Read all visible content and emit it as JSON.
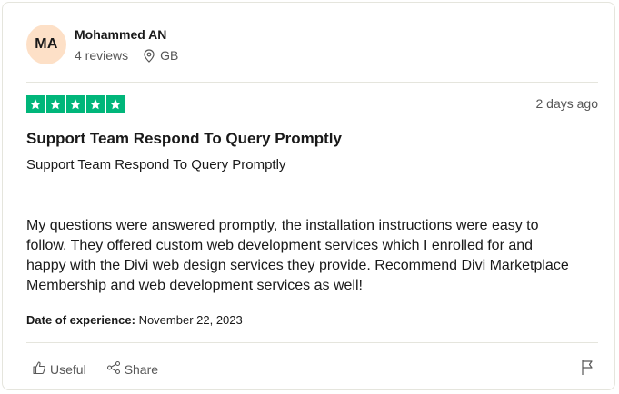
{
  "reviewer": {
    "initials": "MA",
    "name": "Mohammed AN",
    "reviews": "4 reviews",
    "country": "GB",
    "avatar_color": "#fde0c7"
  },
  "rating": {
    "stars": 5,
    "star_color": "#00b67a",
    "posted": "2 days ago"
  },
  "review": {
    "title": "Support Team Respond To Query Promptly",
    "subtitle": "Support Team Respond To Query Promptly",
    "body": "My questions were answered promptly, the installation instructions were easy to follow. They offered custom web development services which I enrolled for and happy with the Divi web design services they provide. Recommend Divi Marketplace Membership and web development services as well!",
    "experience_label": "Date of experience:",
    "experience_date": "November 22, 2023"
  },
  "actions": {
    "useful_label": "Useful",
    "share_label": "Share",
    "icons": [
      "thumbs-up-icon",
      "share-icon",
      "flag-icon"
    ]
  }
}
